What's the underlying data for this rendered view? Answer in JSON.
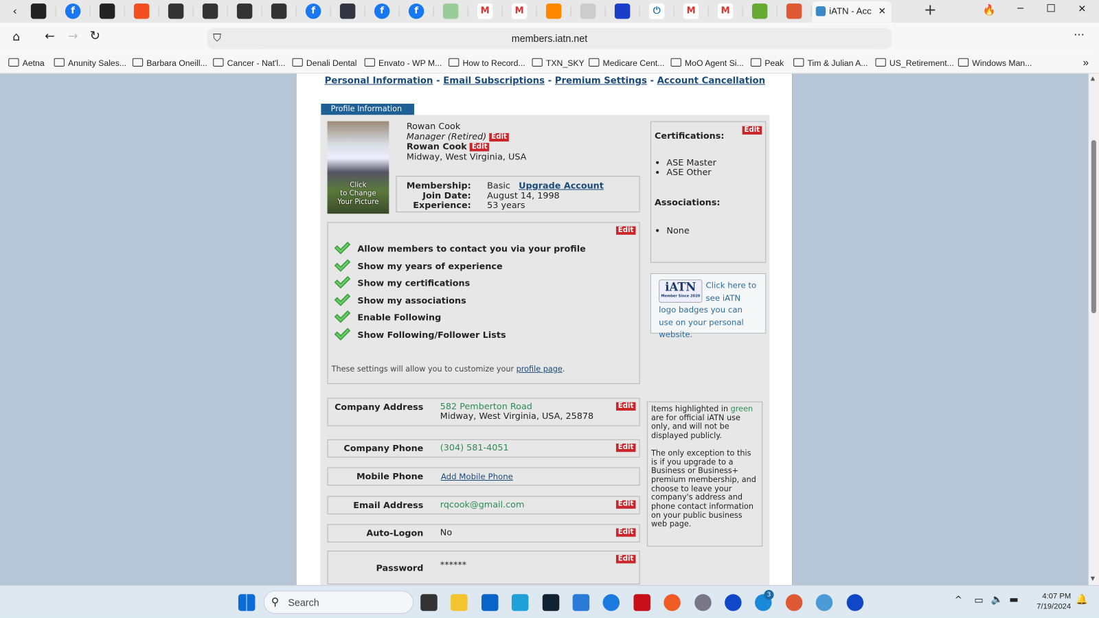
{
  "browser": {
    "tab_icons": [
      "proton-icon",
      "facebook-icon",
      "pinwheel-icon",
      "microsoft-icon",
      "shop-icon",
      "shop-icon",
      "shop-icon",
      "shop-icon",
      "facebook-icon",
      "pdf-icon",
      "facebook-icon",
      "facebook-icon",
      "stripe-icon",
      "gmail-icon",
      "gmail-icon",
      "app-icon",
      "flag-icon",
      "word-icon",
      "power-icon",
      "gmail-icon",
      "gmail-icon",
      "j-icon",
      "duckduckgo-icon"
    ],
    "active_tab": "iATN - Acc",
    "url": "members.iatn.net",
    "bookmarks": [
      "Aetna",
      "Anunity Sales...",
      "Barbara Oneill...",
      "Cancer - Nat'l...",
      "Denali Dental",
      "Envato - WP M...",
      "How to Record...",
      "TXN_SKY",
      "Medicare Cent...",
      "MoO Agent Si...",
      "Peak",
      "Tim & Julian A...",
      "US_Retirement...",
      "Windows Man..."
    ]
  },
  "nav": {
    "links": [
      "Personal Information",
      "Email Subscriptions",
      "Premium Settings",
      "Account Cancellation"
    ],
    "sep": "-"
  },
  "profile": {
    "tab": "Profile Information",
    "photo_caption": [
      "Click",
      "to Change",
      "Your Picture"
    ],
    "name": "Rowan Cook",
    "title": "Manager (Retired)",
    "display_name": "Rowan Cook",
    "location": "Midway, West Virginia, USA",
    "edit": "Edit",
    "membership_label": "Membership:",
    "membership": "Basic",
    "upgrade": "Upgrade Account",
    "join_label": "Join Date:",
    "join": "August 14, 1998",
    "exp_label": "Experience:",
    "exp": "53 years"
  },
  "settings": {
    "items": [
      "Allow members to contact you via your profile",
      "Show my years of experience",
      "Show my certifications",
      "Show my associations",
      "Enable Following",
      "Show Following/Follower Lists"
    ],
    "note": "These settings will allow you to customize your ",
    "note_link": "profile page",
    "note_end": "."
  },
  "certs": {
    "title": "Certifications:",
    "items": [
      "ASE Master",
      "ASE Other"
    ],
    "assoc_title": "Associations:",
    "assoc": [
      "None"
    ]
  },
  "badge": {
    "logo": "iATN",
    "logo_sub": "Member Since 2020",
    "text": "Click here to see iATN logo badges you can use on your personal website."
  },
  "fields": [
    {
      "label": "Company Address",
      "value": "582 Pemberton Road",
      "value2": "Midway, West Virginia, USA, 25878"
    },
    {
      "label": "Company Phone",
      "value": "(304) 581-4051"
    },
    {
      "label": "Mobile Phone",
      "value": "Add Mobile Phone"
    },
    {
      "label": "Email Address",
      "value": "rqcook@gmail.com"
    },
    {
      "label": "Auto-Logon",
      "value": "No"
    },
    {
      "label": "Password",
      "value": "******"
    }
  ],
  "info": {
    "p1a": "Items highlighted in ",
    "p1g": "green",
    "p1b": " are for official iATN use only, and will not be displayed publicly.",
    "p2": "The only exception to this is if you upgrade to a Business or Business+ premium membership, and choose to leave your company's address and phone contact information on your public business web page."
  },
  "taskbar": {
    "search": "Search",
    "time": "4:07 PM",
    "date": "7/19/2024",
    "badge": "3"
  },
  "colors": {
    "accent": "#1e5f95",
    "edit": "#c8262a",
    "green": "#2e8b57",
    "link": "#1a4a7a"
  }
}
